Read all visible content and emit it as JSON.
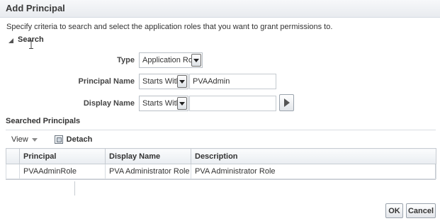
{
  "dialog": {
    "title": "Add Principal",
    "instructions": "Specify criteria to search and select the application roles that you want to grant permissions to."
  },
  "search": {
    "label": "Search",
    "type": {
      "label": "Type",
      "value": "Application Role"
    },
    "principal_name": {
      "label": "Principal Name",
      "operator": "Starts With",
      "value": "PVAAdmin"
    },
    "display_name": {
      "label": "Display Name",
      "operator": "Starts With",
      "value": ""
    }
  },
  "results": {
    "title": "Searched Principals",
    "toolbar": {
      "view_label": "View",
      "detach_label": "Detach"
    },
    "columns": [
      "Principal",
      "Display Name",
      "Description"
    ],
    "rows": [
      [
        "PVAAdminRole",
        "PVA Administrator Role",
        "PVA Administrator Role"
      ]
    ]
  },
  "buttons": {
    "ok": "OK",
    "cancel": "Cancel"
  },
  "icons": {
    "disclosure": "triangle-down-icon",
    "dropdown": "chevron-down-icon",
    "go": "play-icon",
    "detach": "detach-icon",
    "cursor": "text-cursor-icon"
  }
}
